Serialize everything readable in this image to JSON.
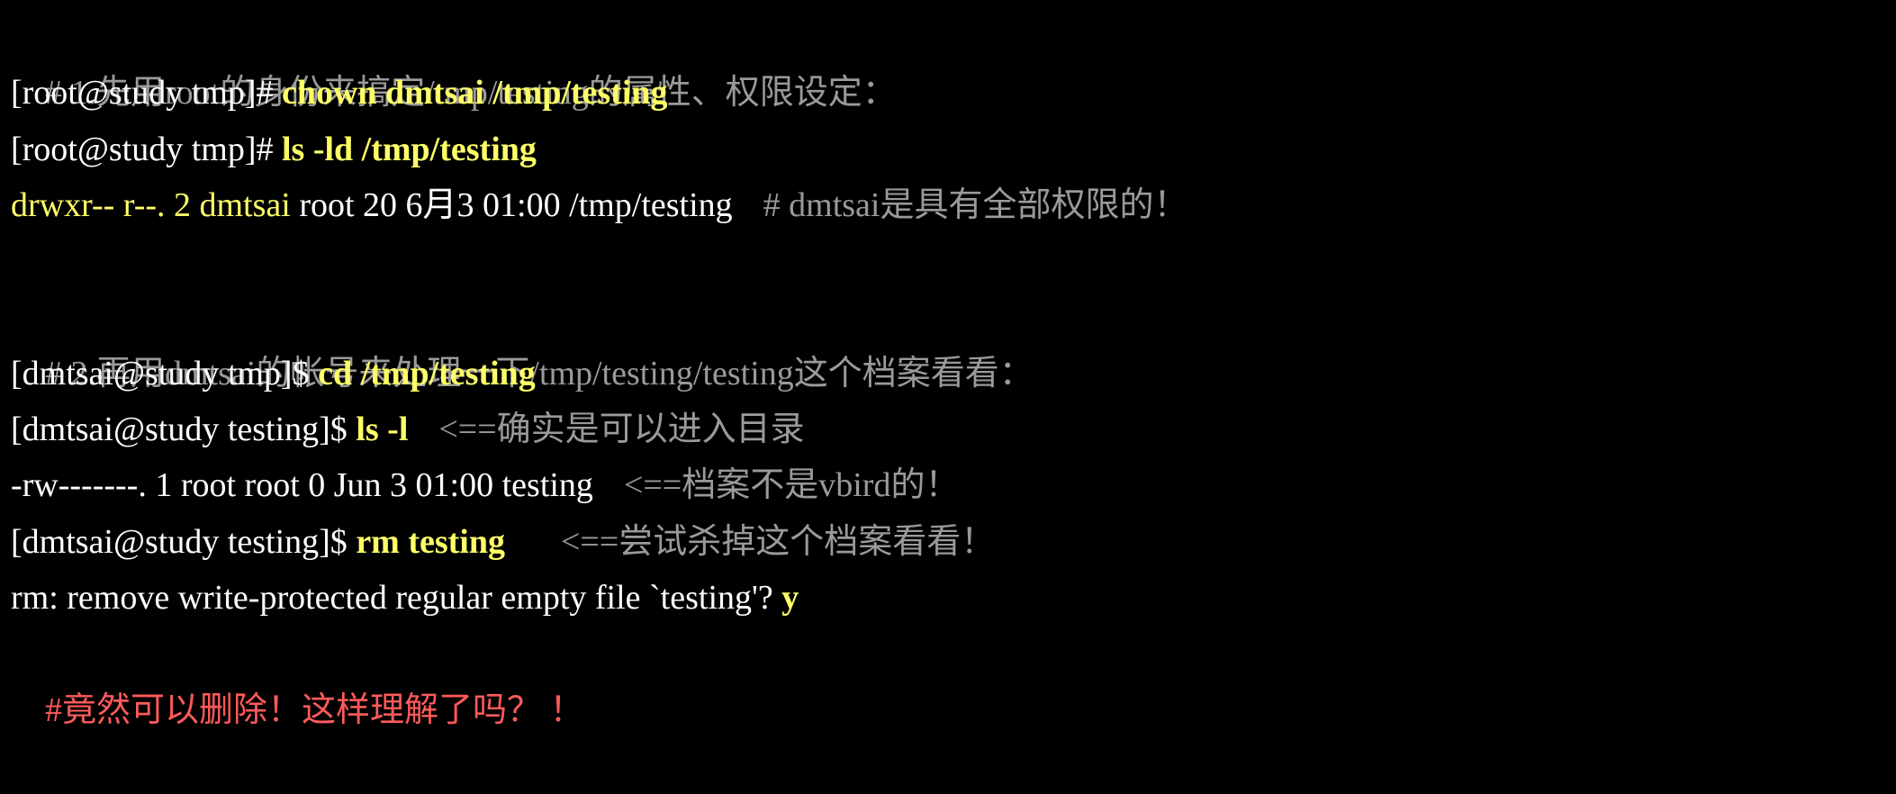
{
  "colors": {
    "background": "#000000",
    "normal_text": "#ffffff",
    "command": "#ffff66",
    "comment": "#9a9a9a",
    "highlight_red": "#ff5a5a"
  },
  "lines": [
    {
      "comment": "# 1.先用root的身份来搞定/tmp/testing的属性、权限设定："
    },
    {
      "prompt": "[root@study tmp]# ",
      "command": "chown dmtsai /tmp/testing"
    },
    {
      "prompt": "[root@study tmp]# ",
      "command": "ls -ld /tmp/testing"
    },
    {
      "perm": "drwxr-- r--. 2 dmtsai",
      "rest": " root 20 6月3 01:00 /tmp/testing",
      "comment": "# dmtsai是具有全部权限的！"
    },
    {
      "blank": ""
    },
    {
      "comment": "# 2.再用dmtsai的帐号来处理一下/tmp/testing/testing这个档案看看："
    },
    {
      "prompt": "[dmtsai@study tmp]$ ",
      "command": "cd /tmp/testing"
    },
    {
      "prompt": "[dmtsai@study testing]$ ",
      "command": "ls -l",
      "comment": "<==确实是可以进入目录"
    },
    {
      "output": "-rw-------. 1 root root 0 Jun 3 01:00 testing",
      "comment": "<==档案不是vbird的！"
    },
    {
      "prompt": "[dmtsai@study testing]$ ",
      "command": "rm testing",
      "comment": "<==尝试杀掉这个档案看看！"
    },
    {
      "output": "rm: remove write-protected regular empty file `testing'? ",
      "answer": "y"
    },
    {
      "note": "#竟然可以删除！这样理解了吗？ ！"
    }
  ]
}
